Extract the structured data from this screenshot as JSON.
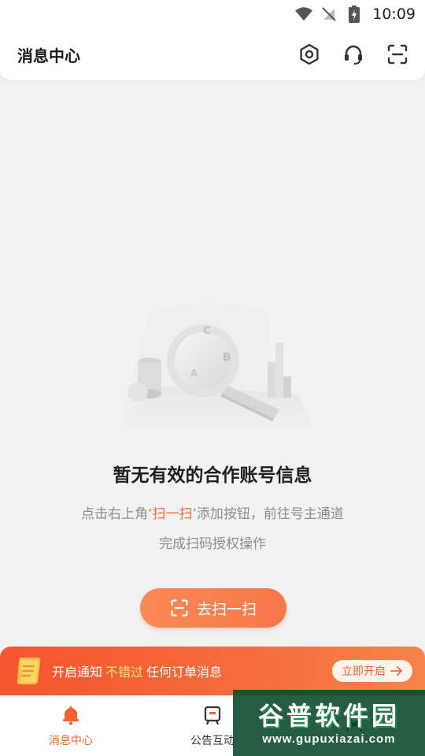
{
  "status_bar": {
    "time": "10:09"
  },
  "header": {
    "title": "消息中心",
    "actions": [
      "hexagon-settings-icon",
      "headset-icon",
      "scan-icon"
    ]
  },
  "empty_state": {
    "title": "暂无有效的合作账号信息",
    "desc_prefix": "点击右上角",
    "desc_highlight": "‘扫一扫’",
    "desc_suffix": "添加按钮，前往号主通道",
    "desc_line2": "完成扫码授权操作",
    "cta_label": "去扫一扫"
  },
  "notify_banner": {
    "text_prefix": "开启通知",
    "text_highlight": "不错过",
    "text_suffix": "任何订单消息",
    "button_label": "立即开启"
  },
  "tabs": [
    {
      "label": "消息中心",
      "active": true,
      "icon": "bell-icon"
    },
    {
      "label": "公告互动",
      "active": false,
      "icon": "notice-board-icon"
    },
    {
      "label": "",
      "active": false,
      "icon": "profile-icon"
    }
  ],
  "watermark": {
    "main": "谷普软件园",
    "url": "www.gupuxiazai.com"
  },
  "colors": {
    "accent": "#f26b35",
    "background": "#f2f2f2"
  }
}
